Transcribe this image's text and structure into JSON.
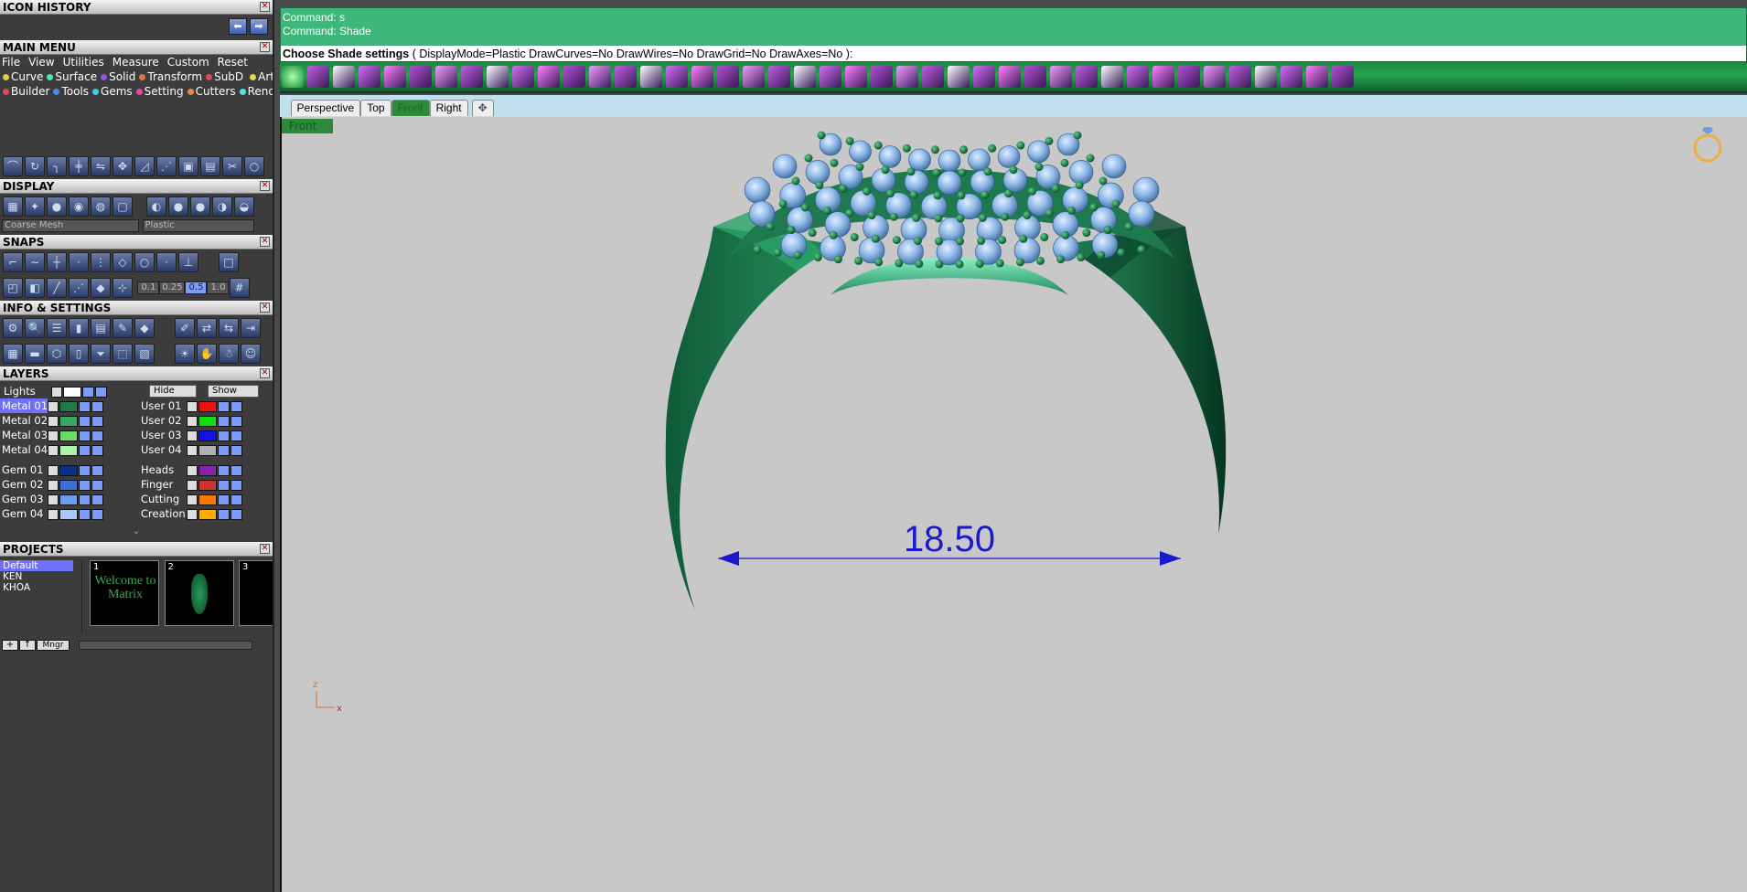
{
  "panels": {
    "icon_history": "ICON HISTORY",
    "main_menu": "MAIN MENU",
    "display": "DISPLAY",
    "snaps": "SNAPS",
    "info_settings": "INFO & SETTINGS",
    "layers": "LAYERS",
    "projects": "PROJECTS"
  },
  "menu": {
    "row1": [
      "File",
      "View",
      "Utilities",
      "Measure",
      "Custom"
    ],
    "reset": "Reset",
    "row2": [
      "Curve",
      "Surface",
      "Solid",
      "Transform",
      "SubD",
      "Art"
    ],
    "row3": [
      "Builder",
      "Tools",
      "Gems",
      "Setting",
      "Cutters",
      "Render"
    ]
  },
  "display": {
    "mesh_select": "Coarse Mesh",
    "material_select": "Plastic"
  },
  "snaps": {
    "values": [
      "0.1",
      "0.25",
      "0.5",
      "1.0"
    ]
  },
  "layers": {
    "lights": "Lights",
    "hide": "Hide",
    "show": "Show",
    "left": [
      {
        "name": "Metal 01",
        "color": "#1f7a4a",
        "active": true
      },
      {
        "name": "Metal 02",
        "color": "#39a85f"
      },
      {
        "name": "Metal 03",
        "color": "#66dd66"
      },
      {
        "name": "Metal 04",
        "color": "#aaf5aa"
      },
      {
        "name": "Gem 01",
        "color": "#0a2e8a"
      },
      {
        "name": "Gem 02",
        "color": "#3a6ed8"
      },
      {
        "name": "Gem 03",
        "color": "#6a9ff0"
      },
      {
        "name": "Gem 04",
        "color": "#a9c9f5"
      }
    ],
    "right": [
      {
        "name": "User 01",
        "color": "#ee1111"
      },
      {
        "name": "User 02",
        "color": "#11dd11"
      },
      {
        "name": "User 03",
        "color": "#1111ee"
      },
      {
        "name": "User 04",
        "color": "#b0b0b0"
      },
      {
        "name": "Heads",
        "color": "#8822aa"
      },
      {
        "name": "Finger",
        "color": "#cc3333"
      },
      {
        "name": "Cutting",
        "color": "#ff7700"
      },
      {
        "name": "Creation",
        "color": "#ffaa00"
      }
    ]
  },
  "projects": {
    "list": [
      "Default",
      "KEN",
      "KHOA"
    ],
    "thumbs": [
      "1",
      "2",
      "3"
    ],
    "thumb1_text": "Welcome to Matrix",
    "mngr": "Mngr"
  },
  "command": {
    "line1": "Command: s",
    "line2": "Command: Shade",
    "prompt_bold": "Choose Shade settings",
    "prompt_rest": " ( DisplayMode=Plastic  DrawCurves=No  DrawWires=No  DrawGrid=No  DrawAxes=No ):"
  },
  "tabs": [
    "Perspective",
    "Top",
    "Front",
    "Right"
  ],
  "active_tab": "Front",
  "viewport": {
    "label": "Front",
    "dimension": "18.50",
    "axis_z": "z",
    "axis_x": "x"
  },
  "colors": {
    "ring_metal": "#1e7a4e",
    "gem": "#8fb8e8",
    "dimension": "#1a1acc",
    "viewport_bg": "#c8c8c8"
  }
}
